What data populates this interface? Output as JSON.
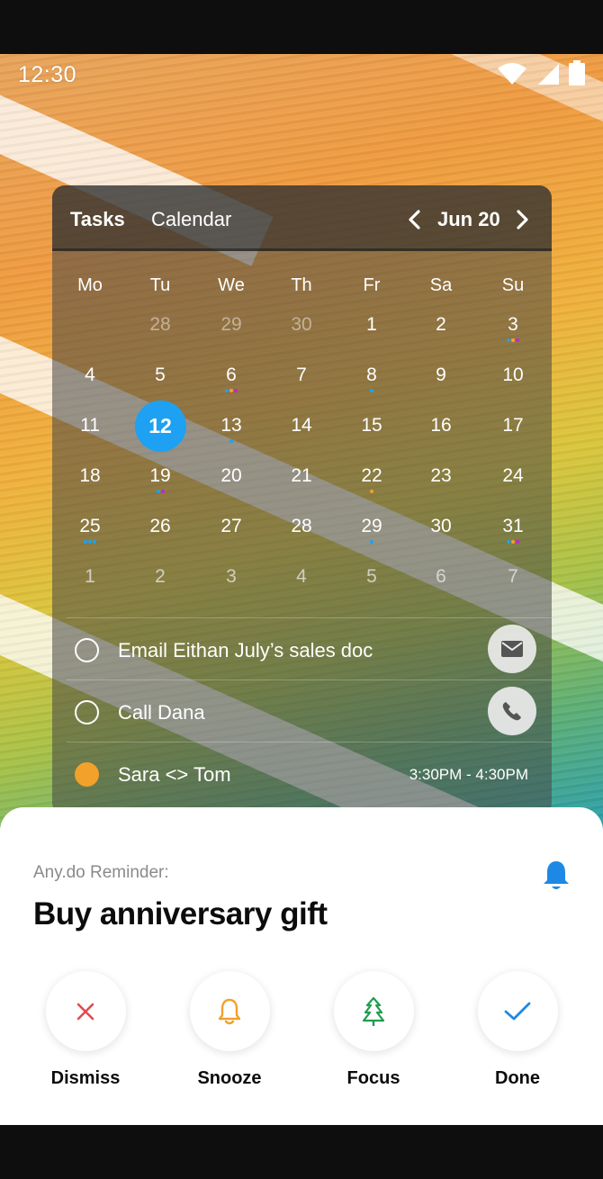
{
  "status_bar": {
    "time": "12:30",
    "icons": [
      "wifi-icon",
      "cellular-signal-icon",
      "battery-icon"
    ]
  },
  "widget": {
    "tabs": {
      "tasks": "Tasks",
      "calendar": "Calendar"
    },
    "month": "Jun 20",
    "weekdays": [
      "Mo",
      "Tu",
      "We",
      "Th",
      "Fr",
      "Sa",
      "Su"
    ],
    "today": "12",
    "weeks": [
      [
        {
          "d": "",
          "dots": []
        },
        {
          "d": "28",
          "muted": true,
          "dots": []
        },
        {
          "d": "29",
          "muted": true,
          "dots": []
        },
        {
          "d": "30",
          "muted": true,
          "dots": []
        },
        {
          "d": "1",
          "dots": []
        },
        {
          "d": "2",
          "dots": []
        },
        {
          "d": "3",
          "dots": [
            "#1ea1f2",
            "#f2a12a",
            "#c026d3"
          ]
        }
      ],
      [
        {
          "d": "4",
          "dots": []
        },
        {
          "d": "5",
          "dots": []
        },
        {
          "d": "6",
          "dots": [
            "#1ea1f2",
            "#f2a12a",
            "#c026d3"
          ]
        },
        {
          "d": "7",
          "dots": []
        },
        {
          "d": "8",
          "dots": [
            "#1ea1f2"
          ]
        },
        {
          "d": "9",
          "dots": []
        },
        {
          "d": "10",
          "dots": []
        }
      ],
      [
        {
          "d": "11",
          "dots": []
        },
        {
          "d": "12",
          "today": true,
          "dots": []
        },
        {
          "d": "13",
          "dots": [
            "#1ea1f2"
          ]
        },
        {
          "d": "14",
          "dots": []
        },
        {
          "d": "15",
          "dots": []
        },
        {
          "d": "16",
          "dots": []
        },
        {
          "d": "17",
          "dots": []
        }
      ],
      [
        {
          "d": "18",
          "dots": []
        },
        {
          "d": "19",
          "dots": [
            "#1ea1f2",
            "#c026d3"
          ]
        },
        {
          "d": "20",
          "dots": []
        },
        {
          "d": "21",
          "dots": []
        },
        {
          "d": "22",
          "dots": [
            "#f2a12a"
          ]
        },
        {
          "d": "23",
          "dots": []
        },
        {
          "d": "24",
          "dots": []
        }
      ],
      [
        {
          "d": "25",
          "dots": [
            "#1ea1f2",
            "#1ea1f2",
            "#1ea1f2"
          ]
        },
        {
          "d": "26",
          "dots": []
        },
        {
          "d": "27",
          "dots": []
        },
        {
          "d": "28",
          "dots": []
        },
        {
          "d": "29",
          "dots": [
            "#1ea1f2"
          ]
        },
        {
          "d": "30",
          "dots": []
        },
        {
          "d": "31",
          "dots": [
            "#1ea1f2",
            "#f2a12a",
            "#c026d3"
          ]
        }
      ],
      [
        {
          "d": "1",
          "gray": true,
          "dots": []
        },
        {
          "d": "2",
          "gray": true,
          "dots": []
        },
        {
          "d": "3",
          "gray": true,
          "dots": []
        },
        {
          "d": "4",
          "gray": true,
          "dots": []
        },
        {
          "d": "5",
          "gray": true,
          "dots": []
        },
        {
          "d": "6",
          "gray": true,
          "dots": []
        },
        {
          "d": "7",
          "gray": true,
          "dots": []
        }
      ]
    ],
    "tasks": [
      {
        "label": "Email Eithan July’s sales doc",
        "action_icon": "email-icon"
      },
      {
        "label": "Call Dana",
        "action_icon": "phone-icon"
      },
      {
        "label": "Sara <> Tom",
        "time": "3:30PM - 4:30PM"
      }
    ]
  },
  "reminder": {
    "source": "Any.do Reminder:",
    "title": "Buy anniversary gift",
    "actions": [
      {
        "label": "Dismiss",
        "icon": "close-icon",
        "color": "#e5484d"
      },
      {
        "label": "Snooze",
        "icon": "bell-icon",
        "color": "#f2a12a"
      },
      {
        "label": "Focus",
        "icon": "tree-icon",
        "color": "#1f9d4f"
      },
      {
        "label": "Done",
        "icon": "check-icon",
        "color": "#1e88e5"
      }
    ],
    "accent": "#1e88e5"
  }
}
